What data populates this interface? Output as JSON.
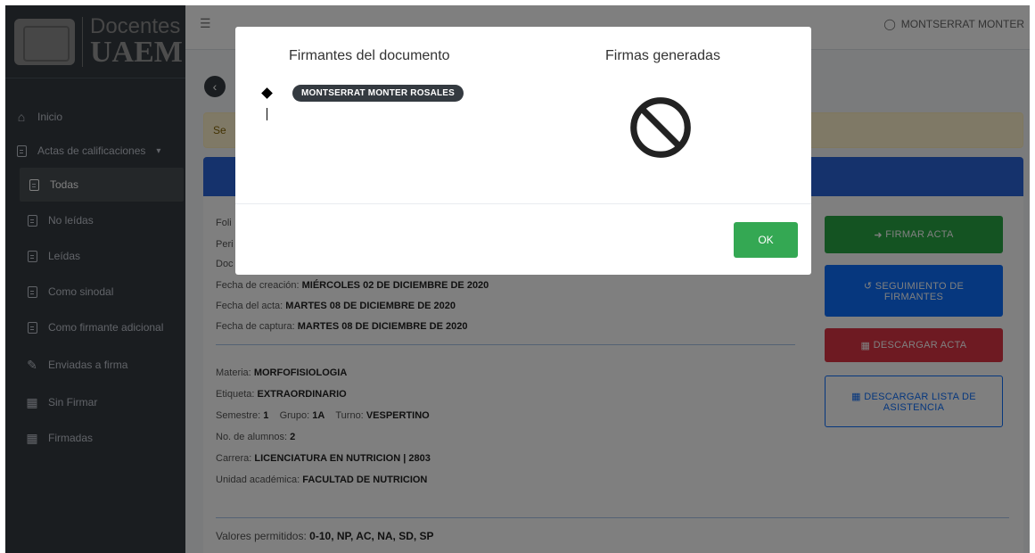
{
  "brand": {
    "top": "Docentes",
    "bottom": "UAEM"
  },
  "sidebar": {
    "items": [
      {
        "label": "Inicio",
        "icon": "home-icon"
      },
      {
        "label": "Actas de calificaciones",
        "icon": "document-icon"
      },
      {
        "label": "Todas",
        "icon": "document-icon"
      },
      {
        "label": "No leídas",
        "icon": "document-icon"
      },
      {
        "label": "Leídas",
        "icon": "document-icon"
      },
      {
        "label": "Como sinodal",
        "icon": "document-icon"
      },
      {
        "label": "Como firmante adicional",
        "icon": "document-icon"
      },
      {
        "label": "Enviadas a firma",
        "icon": "edit-icon"
      },
      {
        "label": "Sin Firmar",
        "icon": "file-icon"
      },
      {
        "label": "Firmadas",
        "icon": "file-icon"
      }
    ]
  },
  "topbar": {
    "user": "MONTSERRAT MONTER"
  },
  "alert": {
    "text": "Se"
  },
  "info": {
    "folio_prefix": "Foli",
    "periodo_prefix": "Peri",
    "docente_prefix": "Doc",
    "fecha_creacion_label": "Fecha de creación:",
    "fecha_creacion_value": "MIÉRCOLES 02 DE DICIEMBRE DE 2020",
    "fecha_acta_label": "Fecha del acta:",
    "fecha_acta_value": "MARTES 08 DE DICIEMBRE DE 2020",
    "fecha_captura_label": "Fecha de captura:",
    "fecha_captura_value": "MARTES 08 DE DICIEMBRE DE 2020",
    "materia_label": "Materia:",
    "materia_value": "MORFOFISIOLOGIA",
    "etiqueta_label": "Etiqueta:",
    "etiqueta_value": "EXTRAORDINARIO",
    "semestre_label": "Semestre:",
    "semestre_value": "1",
    "grupo_label": "Grupo:",
    "grupo_value": "1A",
    "turno_label": "Turno:",
    "turno_value": "VESPERTINO",
    "alumnos_label": "No. de alumnos:",
    "alumnos_value": "2",
    "carrera_label": "Carrera:",
    "carrera_value": "LICENCIATURA EN NUTRICION | 2803",
    "unidad_label": "Unidad académica:",
    "unidad_value": "FACULTAD DE NUTRICION",
    "valores_label": "Valores permitidos:",
    "valores_value": "0-10, NP, AC, NA, SD, SP"
  },
  "actions": {
    "firmar": "FIRMAR ACTA",
    "seguimiento": "SEGUIMIENTO DE FIRMANTES",
    "descargar": "DESCARGAR ACTA",
    "lista": "DESCARGAR LISTA DE ASISTENCIA"
  },
  "modal": {
    "signers_title": "Firmantes del documento",
    "generated_title": "Firmas generadas",
    "signer_name": "MONTSERRAT MONTER ROSALES",
    "ok_label": "OK"
  },
  "colors": {
    "sidebar": "#343a40",
    "primary": "#0d6efd",
    "success": "#28a745",
    "danger": "#dc3545",
    "warning_bg": "#fff3cd",
    "header_blue": "#2b64d8"
  }
}
